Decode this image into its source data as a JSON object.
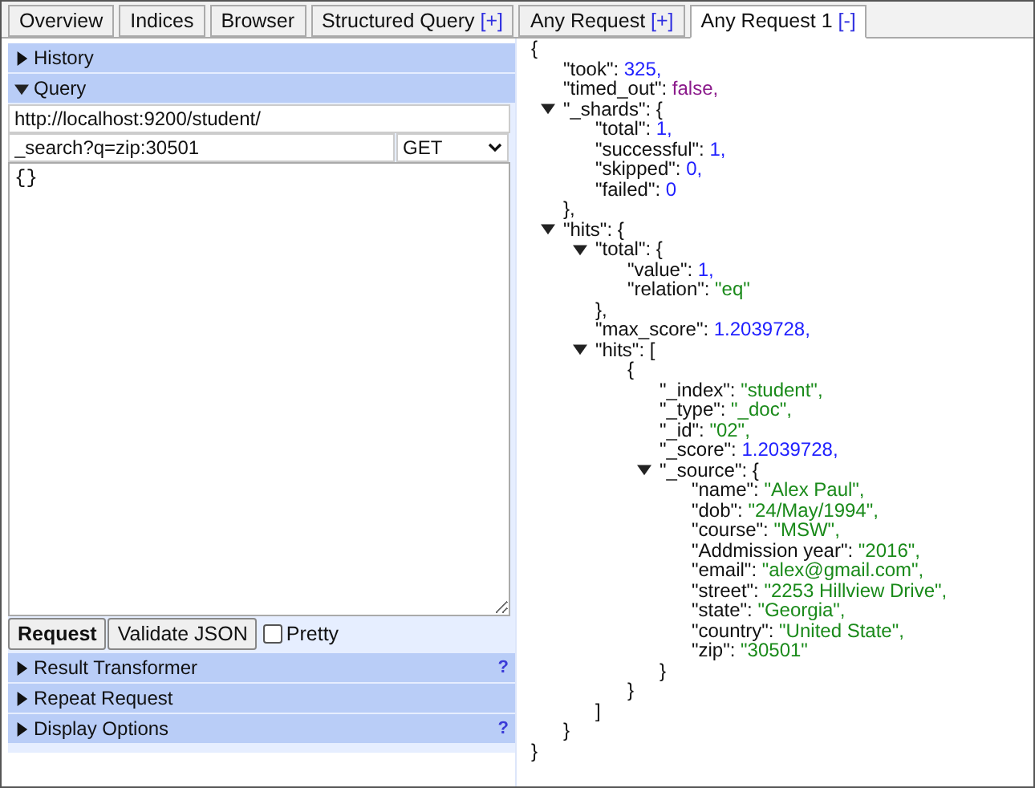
{
  "tabs": [
    {
      "label": "Overview",
      "selected": false
    },
    {
      "label": "Indices",
      "selected": false
    },
    {
      "label": "Browser",
      "selected": false
    },
    {
      "label": "Structured Query",
      "suffix": "[+]",
      "selected": false
    },
    {
      "label": "Any Request",
      "suffix": "[+]",
      "selected": false
    },
    {
      "label": "Any Request 1",
      "suffix": "[-]",
      "selected": true
    }
  ],
  "sections_top": [
    {
      "label": "History",
      "expanded": false
    },
    {
      "label": "Query",
      "expanded": true
    }
  ],
  "query": {
    "url": "http://localhost:9200/student/",
    "path": "_search?q=zip:30501",
    "method": "GET",
    "body": "{}"
  },
  "buttons": [
    "Request",
    "Validate JSON"
  ],
  "pretty": {
    "label": "Pretty",
    "checked": false
  },
  "sections_bottom": [
    {
      "label": "Result Transformer",
      "expanded": false,
      "help": "?"
    },
    {
      "label": "Repeat Request",
      "expanded": false
    },
    {
      "label": "Display Options",
      "expanded": false,
      "help": "?"
    }
  ],
  "result": {
    "kind": "object",
    "open": "{",
    "close": "}",
    "children": [
      {
        "kind": "number",
        "key": "\"took\": ",
        "value": "325,"
      },
      {
        "kind": "boolean",
        "key": "\"timed_out\": ",
        "value": "false,"
      },
      {
        "kind": "object",
        "key": "\"_shards\": ",
        "open": "{",
        "close": "},",
        "expanded": true,
        "children": [
          {
            "kind": "number",
            "key": "\"total\": ",
            "value": "1,"
          },
          {
            "kind": "number",
            "key": "\"successful\": ",
            "value": "1,"
          },
          {
            "kind": "number",
            "key": "\"skipped\": ",
            "value": "0,"
          },
          {
            "kind": "number",
            "key": "\"failed\": ",
            "value": "0"
          }
        ]
      },
      {
        "kind": "object",
        "key": "\"hits\": ",
        "open": "{",
        "close": "}",
        "expanded": true,
        "children": [
          {
            "kind": "object",
            "key": "\"total\": ",
            "open": "{",
            "close": "},",
            "expanded": true,
            "children": [
              {
                "kind": "number",
                "key": "\"value\": ",
                "value": "1,"
              },
              {
                "kind": "string",
                "key": "\"relation\": ",
                "value": "\"eq\""
              }
            ]
          },
          {
            "kind": "number",
            "key": "\"max_score\": ",
            "value": "1.2039728,"
          },
          {
            "kind": "array",
            "key": "\"hits\": ",
            "open": "[",
            "close": "]",
            "expanded": true,
            "children": [
              {
                "kind": "object",
                "open": "{",
                "close": "}",
                "children": [
                  {
                    "kind": "string",
                    "key": "\"_index\": ",
                    "value": "\"student\","
                  },
                  {
                    "kind": "string",
                    "key": "\"_type\": ",
                    "value": "\"_doc\","
                  },
                  {
                    "kind": "string",
                    "key": "\"_id\": ",
                    "value": "\"02\","
                  },
                  {
                    "kind": "number",
                    "key": "\"_score\": ",
                    "value": "1.2039728,"
                  },
                  {
                    "kind": "object",
                    "key": "\"_source\": ",
                    "open": "{",
                    "close": "}",
                    "expanded": true,
                    "children": [
                      {
                        "kind": "string",
                        "key": "\"name\": ",
                        "value": "\"Alex Paul\","
                      },
                      {
                        "kind": "string",
                        "key": "\"dob\": ",
                        "value": "\"24/May/1994\","
                      },
                      {
                        "kind": "string",
                        "key": "\"course\": ",
                        "value": "\"MSW\","
                      },
                      {
                        "kind": "string",
                        "key": "\"Addmission year\": ",
                        "value": "\"2016\","
                      },
                      {
                        "kind": "string",
                        "key": "\"email\": ",
                        "value": "\"alex@gmail.com\","
                      },
                      {
                        "kind": "string",
                        "key": "\"street\": ",
                        "value": "\"2253 Hillview Drive\","
                      },
                      {
                        "kind": "string",
                        "key": "\"state\": ",
                        "value": "\"Georgia\","
                      },
                      {
                        "kind": "string",
                        "key": "\"country\": ",
                        "value": "\"United State\","
                      },
                      {
                        "kind": "string",
                        "key": "\"zip\": ",
                        "value": "\"30501\""
                      }
                    ]
                  }
                ]
              }
            ]
          }
        ]
      }
    ]
  }
}
